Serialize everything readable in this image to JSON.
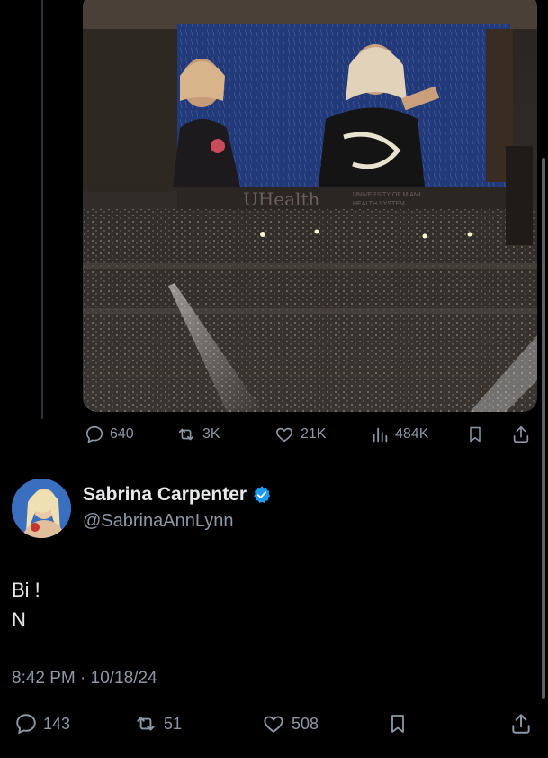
{
  "quoted_post": {
    "stats": {
      "replies": "640",
      "reposts": "3K",
      "likes": "21K",
      "views": "484K"
    }
  },
  "post": {
    "author": {
      "display_name": "Sabrina Carpenter",
      "handle": "@SabrinaAnnLynn",
      "verified": true
    },
    "text_lines": [
      "Bi !",
      "N"
    ],
    "timestamp": "8:42 PM · 10/18/24",
    "stats": {
      "replies": "143",
      "reposts": "51",
      "likes": "508"
    }
  },
  "media": {
    "signage_main": "UHealth",
    "signage_sub_1": "UNIVERSITY OF MIAMI",
    "signage_sub_2": "HEALTH SYSTEM"
  },
  "colors": {
    "background": "#000000",
    "text_primary": "#e7e9ea",
    "text_secondary": "#8b98a5",
    "verified": "#1d9bf0"
  }
}
